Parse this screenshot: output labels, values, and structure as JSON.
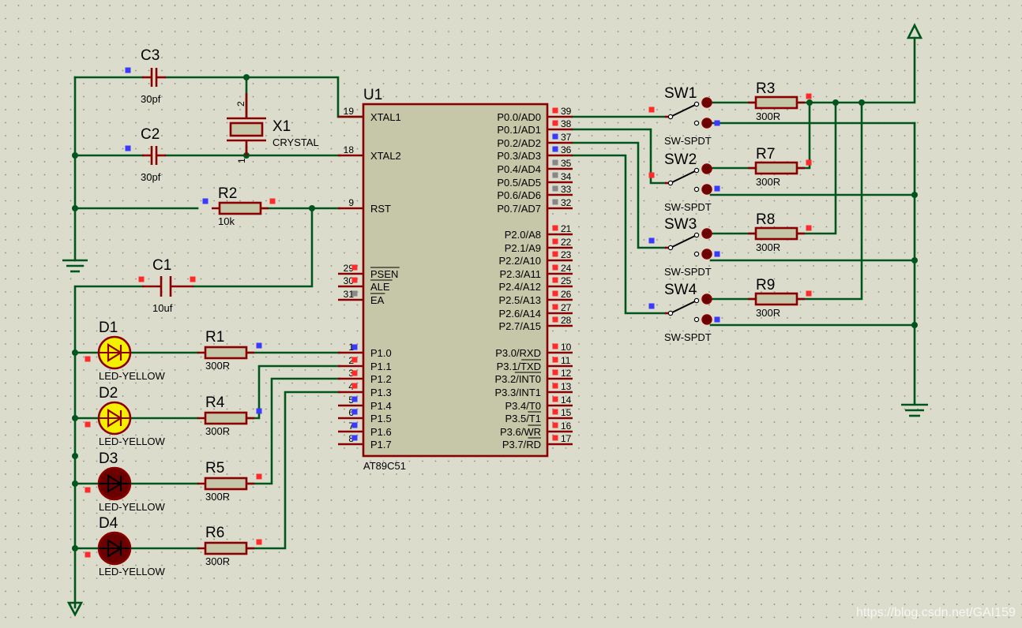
{
  "colors": {
    "background": "#dcdccc",
    "grid_dot": "#8a8a7e",
    "wire": "#00551d",
    "pin": "#8a0000",
    "ic_fill": "#c6c6a8",
    "led_yellow": "#f5f000",
    "led_dark": "#6a0000",
    "marker_red": "#ff2b2b",
    "marker_blue": "#3a3aff",
    "marker_grey": "#888888"
  },
  "chip": {
    "ref": "U1",
    "part": "AT89C51"
  },
  "crystal": {
    "ref": "X1",
    "value": "CRYSTAL",
    "pin_top": "2",
    "pin_bottom": "1"
  },
  "capacitors": {
    "c3": {
      "ref": "C3",
      "value": "30pf"
    },
    "c2": {
      "ref": "C2",
      "value": "30pf"
    },
    "c1": {
      "ref": "C1",
      "value": "10uf"
    }
  },
  "resistors": {
    "r2": {
      "ref": "R2",
      "value": "10k"
    },
    "r1": {
      "ref": "R1",
      "value": "300R"
    },
    "r4": {
      "ref": "R4",
      "value": "300R"
    },
    "r5": {
      "ref": "R5",
      "value": "300R"
    },
    "r6": {
      "ref": "R6",
      "value": "300R"
    },
    "r3": {
      "ref": "R3",
      "value": "300R"
    },
    "r7": {
      "ref": "R7",
      "value": "300R"
    },
    "r8": {
      "ref": "R8",
      "value": "300R"
    },
    "r9": {
      "ref": "R9",
      "value": "300R"
    }
  },
  "leds": {
    "d1": {
      "ref": "D1",
      "value": "LED-YELLOW"
    },
    "d2": {
      "ref": "D2",
      "value": "LED-YELLOW"
    },
    "d3": {
      "ref": "D3",
      "value": "LED-YELLOW"
    },
    "d4": {
      "ref": "D4",
      "value": "LED-YELLOW"
    }
  },
  "switches": {
    "sw1": {
      "ref": "SW1",
      "value": "SW-SPDT"
    },
    "sw2": {
      "ref": "SW2",
      "value": "SW-SPDT"
    },
    "sw3": {
      "ref": "SW3",
      "value": "SW-SPDT"
    },
    "sw4": {
      "ref": "SW4",
      "value": "SW-SPDT"
    }
  },
  "left_pins": [
    {
      "num": "19",
      "name": "XTAL1"
    },
    {
      "num": "18",
      "name": "XTAL2"
    },
    {
      "num": "9",
      "name": "RST"
    },
    {
      "num": "29",
      "name": "PSEN"
    },
    {
      "num": "30",
      "name": "ALE"
    },
    {
      "num": "31",
      "name": "EA"
    },
    {
      "num": "1",
      "name": "P1.0"
    },
    {
      "num": "2",
      "name": "P1.1"
    },
    {
      "num": "3",
      "name": "P1.2"
    },
    {
      "num": "4",
      "name": "P1.3"
    },
    {
      "num": "5",
      "name": "P1.4"
    },
    {
      "num": "6",
      "name": "P1.5"
    },
    {
      "num": "7",
      "name": "P1.6"
    },
    {
      "num": "8",
      "name": "P1.7"
    }
  ],
  "right_pins": [
    {
      "num": "39",
      "name": "P0.0/AD0"
    },
    {
      "num": "38",
      "name": "P0.1/AD1"
    },
    {
      "num": "37",
      "name": "P0.2/AD2"
    },
    {
      "num": "36",
      "name": "P0.3/AD3"
    },
    {
      "num": "35",
      "name": "P0.4/AD4"
    },
    {
      "num": "34",
      "name": "P0.5/AD5"
    },
    {
      "num": "33",
      "name": "P0.6/AD6"
    },
    {
      "num": "32",
      "name": "P0.7/AD7"
    },
    {
      "num": "21",
      "name": "P2.0/A8"
    },
    {
      "num": "22",
      "name": "P2.1/A9"
    },
    {
      "num": "23",
      "name": "P2.2/A10"
    },
    {
      "num": "24",
      "name": "P2.3/A11"
    },
    {
      "num": "25",
      "name": "P2.4/A12"
    },
    {
      "num": "26",
      "name": "P2.5/A13"
    },
    {
      "num": "27",
      "name": "P2.6/A14"
    },
    {
      "num": "28",
      "name": "P2.7/A15"
    },
    {
      "num": "10",
      "name": "P3.0/RXD"
    },
    {
      "num": "11",
      "name": "P3.1/TXD"
    },
    {
      "num": "12",
      "name": "P3.2/INT0"
    },
    {
      "num": "13",
      "name": "P3.3/INT1"
    },
    {
      "num": "14",
      "name": "P3.4/T0"
    },
    {
      "num": "15",
      "name": "P3.5/T1"
    },
    {
      "num": "16",
      "name": "P3.6/WR"
    },
    {
      "num": "17",
      "name": "P3.7/RD"
    }
  ],
  "watermark": "https://blog.csdn.net/GAI159"
}
